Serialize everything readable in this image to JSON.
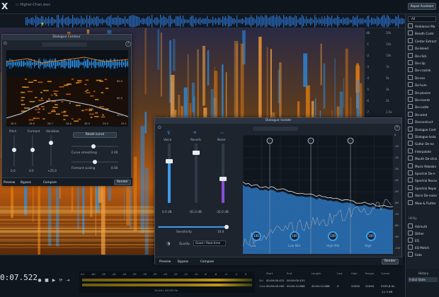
{
  "window": {
    "file_name": "Higher-Chan.wav",
    "assistant_label": "Repair Assistant"
  },
  "transport": {
    "timecode": "0:07.522"
  },
  "modules": {
    "filter_value": "All",
    "items": [
      "Ambience Ma",
      "Breath Contr",
      "Center Extract",
      "De-bleed",
      "De-click",
      "De-clip",
      "De-crackle",
      "De-ess",
      "De-hum",
      "De-plosive",
      "De-reverb",
      "De-rustle",
      "De-wind",
      "Deconstruct",
      "Dialogue Cont",
      "Dialogue Isola",
      "Gultar De-no",
      "Interpolate",
      "Mouth De-click",
      "Music Rebalan",
      "Spectral De-n",
      "Spectral Recov",
      "Spectral Repai",
      "Voice De-noise",
      "Wow & Flutter"
    ],
    "utility_label": "Utility",
    "utility_items": [
      "Azimuth",
      "Dither",
      "EQ",
      "EQ Match",
      "Fade"
    ]
  },
  "history": {
    "title": "History",
    "item": "Initial State"
  },
  "ruler": {
    "db_left": [
      "dB",
      "-1",
      "-2",
      "-3",
      "-4",
      "-5",
      "-6",
      "-7",
      "-8",
      "-10",
      "-12",
      "-15",
      "-20",
      "-30"
    ],
    "hz_right": [
      "20k",
      "15k",
      "10k",
      "7k",
      "5k",
      "3k",
      "2k",
      "1.5k",
      "1k",
      "700",
      "500",
      "300",
      "200",
      "100"
    ]
  },
  "meter": {
    "labels": [
      "Inf",
      "-60",
      "-50",
      "-45",
      "-40",
      "-35",
      "-30",
      "-25",
      "-20",
      "-15",
      "-12",
      "-10",
      "-8",
      "-6",
      "-4",
      "-2",
      "0"
    ]
  },
  "selection": {
    "headers": [
      "Start",
      "End",
      "Length",
      "Low",
      "High",
      "Range",
      "Cursor"
    ],
    "sel_label": "Sel",
    "view_label": "View",
    "sel_values": [
      "00:00:00.431",
      "00:00:00.431",
      "",
      "",
      "",
      "",
      ""
    ],
    "view_values": [
      "00:00:00.000",
      "00:00:12.866",
      "00:00:12.866",
      "0",
      "22050",
      "22050",
      "5335.8 Hz"
    ],
    "format": "24-bit | 44100 Hz",
    "sel_unit": "Hz",
    "cursor_val": "-11.3 dB"
  },
  "dialogue_contour": {
    "title": "Dialogue Contour",
    "labels": [
      "Pitch",
      "Formant",
      "Variation"
    ],
    "values": [
      "0.0",
      "0.0",
      "+25.0"
    ],
    "reset_label": "Reset curve",
    "curve_smoothing_label": "Curve smoothing",
    "curve_smoothing_value": "2.00",
    "formant_scaling_label": "Formant scaling",
    "formant_scaling_value": "0.00",
    "preview": "Preview",
    "bypass": "Bypass",
    "compare": "Compare",
    "render": "Render",
    "pitch_axis": [
      "80.0",
      "60.0",
      "40.0"
    ],
    "time_axis": [
      "28.5",
      "28.6",
      "28.7",
      "28.8",
      "28.9",
      "29.0",
      "29.1"
    ]
  },
  "dialogue_isolate": {
    "title": "Dialogue Isolate",
    "channels": [
      {
        "label": "Voice",
        "value": "0.0 dB"
      },
      {
        "label": "Reverb",
        "value": "-61.0 dB"
      },
      {
        "label": "Noise",
        "value": "-32.0 dB"
      }
    ],
    "sensitivity_label": "Sensitivity",
    "sensitivity_value": "10.0",
    "quality_label": "Quality",
    "quality_value": "Good / Real-time",
    "bands": [
      {
        "label": "Low",
        "value": "100"
      },
      {
        "label": "Low Mid",
        "value": "100"
      },
      {
        "label": "High Mid",
        "value": "100"
      },
      {
        "label": "High",
        "value": "100"
      }
    ],
    "db_axis": [
      "0",
      "-10",
      "-20",
      "-30",
      "-40",
      "-50",
      "-60",
      "-70",
      "-80",
      "-90",
      "-100"
    ],
    "preview": "Preview",
    "bypass": "Bypass",
    "compare": "Compare",
    "render": "Render"
  },
  "colors": {
    "accent": "#3f9be8",
    "spectro_hot": "#e07a12",
    "spectro_blue": "#2a8fe6"
  }
}
